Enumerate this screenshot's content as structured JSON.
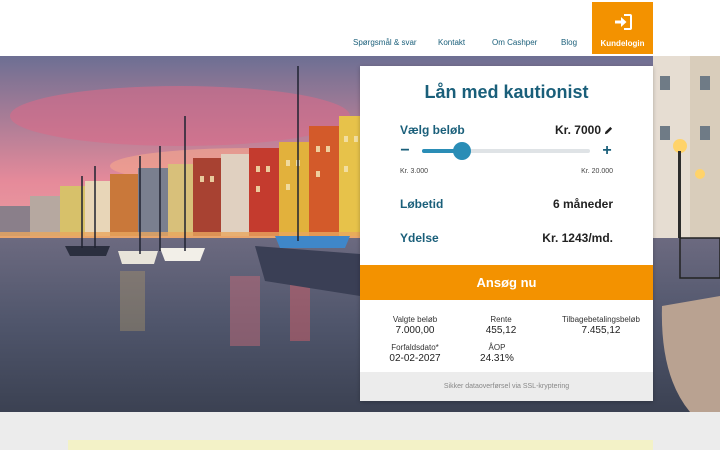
{
  "nav": {
    "items": [
      "Spørgsmål & svar",
      "Kontakt",
      "Om Cashper",
      "Blog"
    ],
    "login_label": "Kundelogin"
  },
  "calculator": {
    "title": "Lån med kautionist",
    "amount_label": "Vælg beløb",
    "amount_value": "Kr. 7000",
    "slider": {
      "min_label": "Kr. 3.000",
      "max_label": "Kr. 20.000",
      "min": 3000,
      "max": 20000,
      "value": 7000
    },
    "minus_symbol": "−",
    "plus_symbol": "+",
    "term_label": "Løbetid",
    "term_value": "6 måneder",
    "payment_label": "Ydelse",
    "payment_value": "Kr. 1243/md.",
    "cta_label": "Ansøg nu",
    "summary": {
      "chosen_amount_label": "Valgte beløb",
      "chosen_amount_value": "7.000,00",
      "interest_label": "Rente",
      "interest_value": "455,12",
      "repayment_label": "Tilbagebetalingsbeløb",
      "repayment_value": "7.455,12",
      "due_date_label": "Forfaldsdato*",
      "due_date_value": "02-02-2027",
      "aop_label": "ÅOP",
      "aop_value": "24.31%"
    },
    "secure_note": "Sikker dataoverførsel via SSL-kryptering"
  },
  "colors": {
    "brand_blue": "#1a5f7a",
    "accent_orange": "#f39200",
    "slider_blue": "#2a8db6"
  },
  "icons": {
    "login": "sign-in-icon",
    "edit": "pencil-icon"
  }
}
